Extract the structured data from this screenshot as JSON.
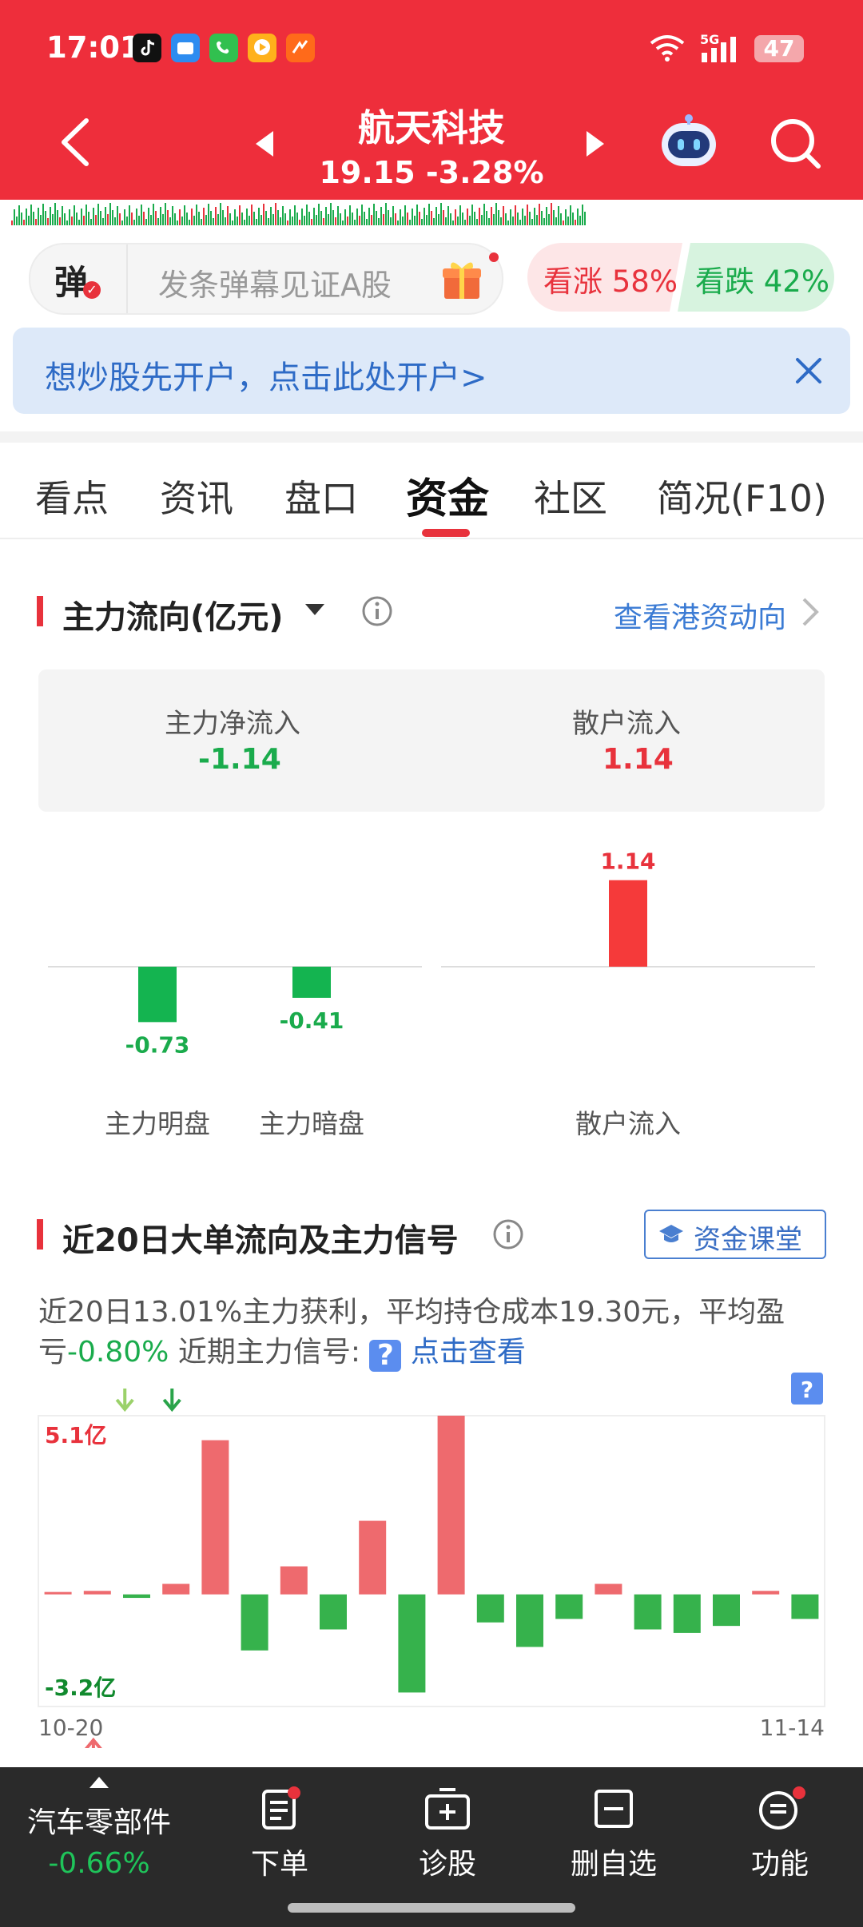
{
  "status_bar": {
    "time": "17:01",
    "network": "5G",
    "battery": "47",
    "app_icons": [
      "tiktok-icon",
      "files-icon",
      "phone-icon",
      "video-icon",
      "news-icon"
    ]
  },
  "header": {
    "stock_name": "航天科技",
    "price_line": "19.15 -3.28%",
    "back_icon": "back-arrow-icon",
    "prev_icon": "triangle-left-icon",
    "next_icon": "triangle-right-icon",
    "robot_icon": "assistant-robot-icon",
    "search_icon": "search-icon"
  },
  "barrage": {
    "badge": "弹",
    "placeholder": "发条弹幕见证A股",
    "bull_label": "看涨 58%",
    "bear_label": "看跌 42%",
    "bull_pct": 58,
    "bear_pct": 42
  },
  "banner": {
    "text": "想炒股先开户，点击此处开户>"
  },
  "tabs": [
    {
      "label": "看点"
    },
    {
      "label": "资讯"
    },
    {
      "label": "盘口"
    },
    {
      "label": "资金"
    },
    {
      "label": "社区"
    },
    {
      "label": "简况(F10)"
    }
  ],
  "active_tab": "资金",
  "main_flow": {
    "title": "主力流向(亿元)",
    "link": "查看港资动向",
    "net_label": "主力净流入",
    "net_value": "-1.14",
    "retail_label": "散户流入",
    "retail_value": "1.14"
  },
  "chart_data": [
    {
      "type": "bar",
      "categories": [
        "主力明盘",
        "主力暗盘",
        "散户流入"
      ],
      "values": [
        -0.73,
        -0.41,
        1.14
      ],
      "labels": [
        "-0.73",
        "-0.41",
        "1.14"
      ]
    },
    {
      "type": "bar",
      "title": "近20日大单流向及主力信号",
      "x_start": "10-20",
      "x_end": "11-14",
      "ymax_label": "5.1亿",
      "ymin_label": "-3.2亿",
      "ylim": [
        -3.2,
        5.1
      ],
      "values": [
        0.05,
        0.1,
        -0.1,
        0.3,
        4.4,
        -1.6,
        0.8,
        -1.0,
        2.1,
        -2.8,
        5.1,
        -0.8,
        -1.5,
        -0.7,
        0.3,
        -1.0,
        -1.1,
        -0.9,
        0.1,
        -0.7
      ]
    }
  ],
  "signal_section": {
    "title": "近20日大单流向及主力信号",
    "course_button": "资金课堂",
    "desc_part1": "近20日13.01%主力获利，平均持仓成本19.30元，平均盈亏",
    "desc_pct": "-0.80%",
    "desc_part2": "近期主力信号:",
    "desc_link": "点击查看",
    "help_badge": "?"
  },
  "bottom_nav": {
    "sector_name": "汽车零部件",
    "sector_change": "-0.66%",
    "items": [
      {
        "label": "下单",
        "icon": "order-icon"
      },
      {
        "label": "诊股",
        "icon": "diagnose-icon"
      },
      {
        "label": "删自选",
        "icon": "remove-watchlist-icon"
      },
      {
        "label": "功能",
        "icon": "menu-icon"
      }
    ]
  }
}
